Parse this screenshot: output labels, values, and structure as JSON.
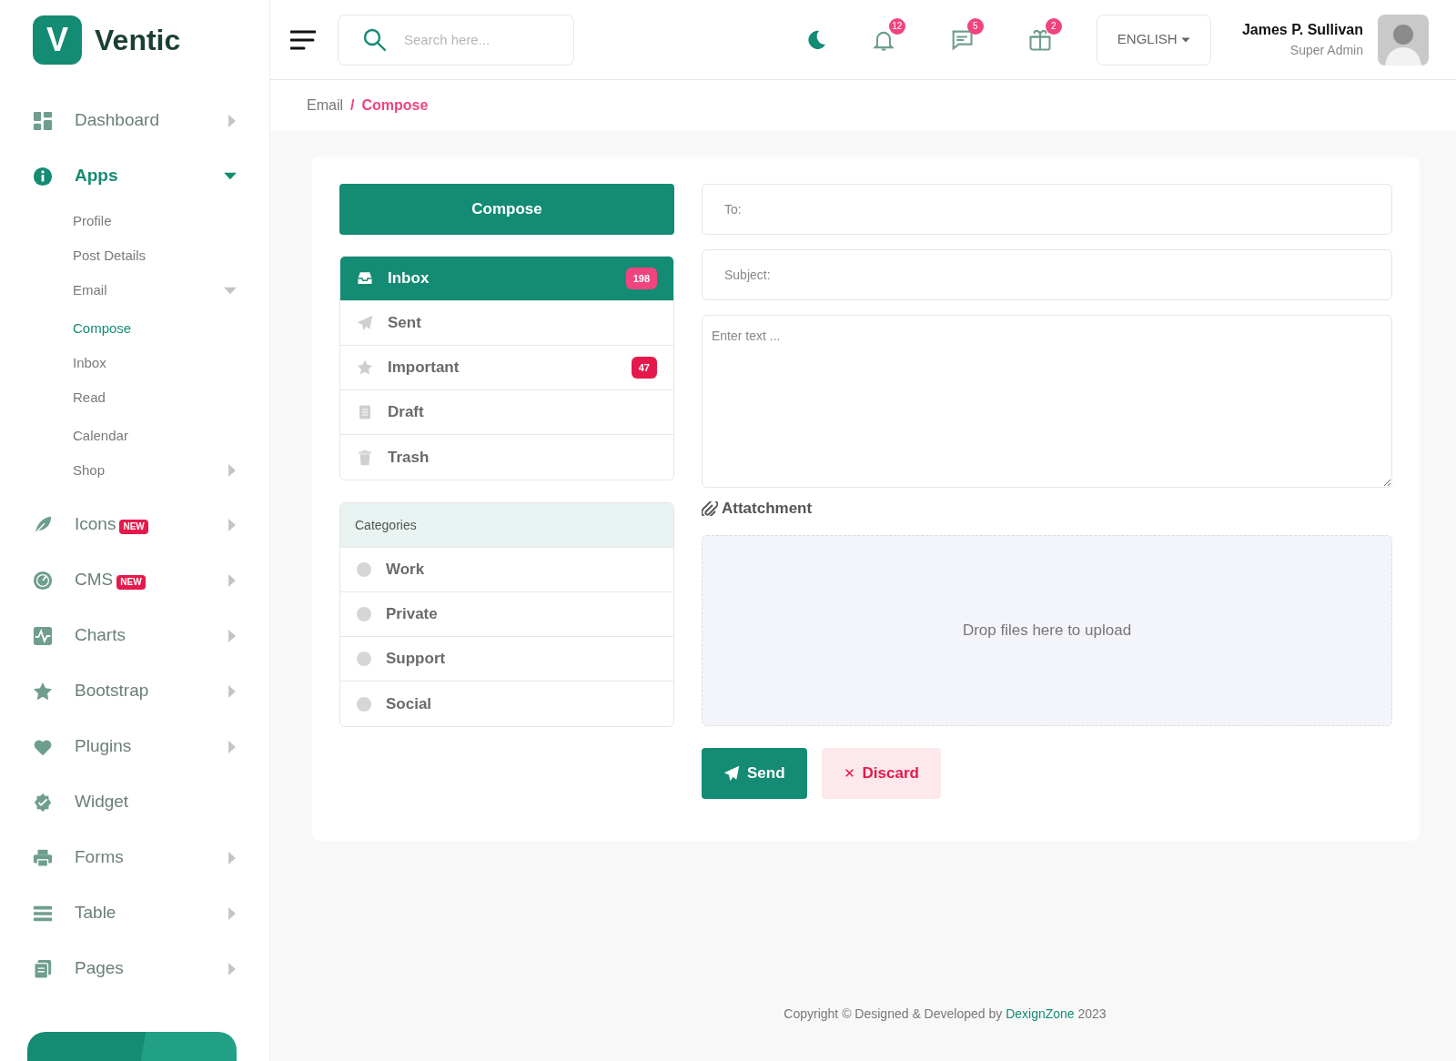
{
  "brand": {
    "name": "Ventic",
    "logo_letter": "V"
  },
  "sidebar": {
    "items": [
      {
        "label": "Dashboard",
        "has_children": true,
        "expanded": false,
        "selected": false
      },
      {
        "label": "Apps",
        "has_children": true,
        "expanded": true,
        "selected": true,
        "children": [
          {
            "label": "Profile",
            "selected": false
          },
          {
            "label": "Post Details",
            "selected": false
          },
          {
            "label": "Email",
            "selected": false,
            "has_children": true,
            "expanded": true,
            "children": [
              {
                "label": "Compose",
                "selected": true
              },
              {
                "label": "Inbox",
                "selected": false
              },
              {
                "label": "Read",
                "selected": false
              }
            ]
          },
          {
            "label": "Calendar",
            "selected": false
          },
          {
            "label": "Shop",
            "selected": false,
            "has_children": true,
            "expanded": false
          }
        ]
      },
      {
        "label": "Icons",
        "badge": "NEW",
        "has_children": true,
        "expanded": false,
        "selected": false
      },
      {
        "label": "CMS",
        "badge": "NEW",
        "has_children": true,
        "expanded": false,
        "selected": false
      },
      {
        "label": "Charts",
        "has_children": true,
        "expanded": false,
        "selected": false
      },
      {
        "label": "Bootstrap",
        "has_children": true,
        "expanded": false,
        "selected": false
      },
      {
        "label": "Plugins",
        "has_children": true,
        "expanded": false,
        "selected": false
      },
      {
        "label": "Widget",
        "has_children": false,
        "selected": false
      },
      {
        "label": "Forms",
        "has_children": true,
        "expanded": false,
        "selected": false
      },
      {
        "label": "Table",
        "has_children": true,
        "expanded": false,
        "selected": false
      },
      {
        "label": "Pages",
        "has_children": true,
        "expanded": false,
        "selected": false
      }
    ]
  },
  "header": {
    "search": {
      "placeholder": "Search here..."
    },
    "notifications": [
      {
        "count": "12"
      },
      {
        "count": "5"
      },
      {
        "count": "2"
      }
    ],
    "language": "ENGLISH",
    "user": {
      "name": "James P. Sullivan",
      "role": "Super Admin"
    }
  },
  "breadcrumb_separator": "/",
  "breadcrumb": [
    {
      "label": "Email",
      "selected": false
    },
    {
      "label": "Compose",
      "selected": true
    }
  ],
  "mail": {
    "compose_button": "Compose",
    "folders": [
      {
        "label": "Inbox",
        "selected": true,
        "badge": "198",
        "color": "#f0447e"
      },
      {
        "label": "Sent",
        "selected": false
      },
      {
        "label": "Important",
        "selected": false,
        "badge": "47",
        "color": "#e5194b"
      },
      {
        "label": "Draft",
        "selected": false
      },
      {
        "label": "Trash",
        "selected": false
      }
    ],
    "categories_title": "Categories",
    "categories": [
      {
        "label": "Work"
      },
      {
        "label": "Private"
      },
      {
        "label": "Support"
      },
      {
        "label": "Social"
      }
    ]
  },
  "compose": {
    "to": {
      "placeholder": "To:"
    },
    "subject": {
      "placeholder": "Subject:"
    },
    "body": {
      "placeholder": "Enter text ..."
    },
    "attachment_label": "Attatchment",
    "dropzone": "Drop files here to upload",
    "buttons": [
      {
        "label": "Send",
        "kind": "primary"
      },
      {
        "label": "Discard",
        "kind": "danger"
      }
    ]
  },
  "footer": {
    "text": "Copyright © Designed & Developed by ",
    "link": "DexignZone",
    "year": " 2023"
  }
}
